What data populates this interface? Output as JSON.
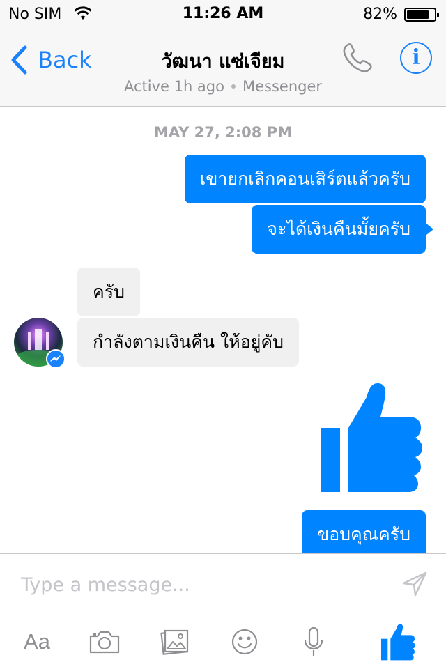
{
  "status_bar": {
    "carrier": "No SIM",
    "time": "11:26 AM",
    "battery_percent": "82%",
    "battery_level": 0.82,
    "wifi_icon": "wifi-icon"
  },
  "nav": {
    "back_label": "Back",
    "contact_name": "วัฒนา แซ่เจียม",
    "active_status": "Active 1h ago",
    "platform": "Messenger",
    "call_icon": "phone-icon",
    "info_icon": "info-icon",
    "info_glyph": "i"
  },
  "conversation": {
    "timestamp": "MAY 27, 2:08 PM",
    "outgoing_1": "เขายกเลิกคอนเสิร์ตแล้วครับ",
    "outgoing_2": "จะได้เงินคืนมั้ยครับ",
    "incoming_1": "ครับ",
    "incoming_2": "กำลังตามเงินคืน ให้อยู่คับ",
    "sticker": "thumbs-up-icon",
    "outgoing_3": "ขอบคุณครับ"
  },
  "composer": {
    "placeholder": "Type a message...",
    "send_icon": "send-icon",
    "toolbar": {
      "text_label": "Aa",
      "icons": [
        "camera-icon",
        "gallery-icon",
        "emoji-icon",
        "microphone-icon",
        "like-icon"
      ]
    }
  },
  "colors": {
    "accent": "#1a82fb",
    "outgoing_bubble": "#0084ff",
    "incoming_bubble": "#f0f0f0",
    "secondary_text": "#8e8e93"
  }
}
